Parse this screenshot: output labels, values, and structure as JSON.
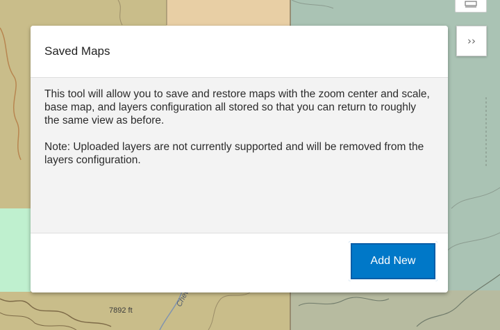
{
  "map": {
    "elevation_label": "7892 ft",
    "river_label": "Chevelon"
  },
  "controls": {
    "expand_icon": "double-chevron-right-icon",
    "expand_glyph": "››",
    "top_icon": "layers-icon"
  },
  "panel": {
    "title": "Saved Maps",
    "paragraph_1": "This tool will allow you to save and restore maps with the zoom center and scale, base map, and layers configuration all stored so that you can return to roughly the same view as before.",
    "paragraph_2": "Note: Uploaded layers are not currently supported and will be removed from the layers configuration.",
    "add_button_label": "Add New"
  },
  "colors": {
    "primary_button": "#0078c8",
    "map_tan": "#c9bd8a",
    "map_peach": "#e8cfa5",
    "map_green": "#a9c3b5",
    "map_lightgreen": "#bff0cf"
  }
}
